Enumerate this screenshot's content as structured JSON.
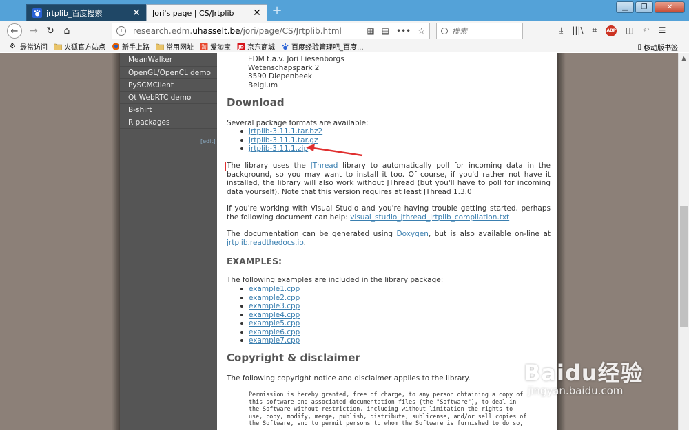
{
  "tabs": [
    {
      "label": "jrtplib_百度搜索",
      "active": false
    },
    {
      "label": "Jori's page | CS/Jrtplib",
      "active": true
    }
  ],
  "navbar": {
    "url_prefix": "research.edm.",
    "url_domain": "uhasselt.be",
    "url_path": "/jori/page/CS/Jrtplib.html",
    "search_placeholder": "搜索"
  },
  "bookmarks": [
    {
      "label": "最常访问",
      "icon": "gear-icon"
    },
    {
      "label": "火狐官方站点",
      "icon": "folder-icon"
    },
    {
      "label": "新手上路",
      "icon": "firefox-icon"
    },
    {
      "label": "常用网址",
      "icon": "folder-icon"
    },
    {
      "label": "爱淘宝",
      "icon": "taobao-icon"
    },
    {
      "label": "京东商城",
      "icon": "jd-icon"
    },
    {
      "label": "百度经验管理吧_百度...",
      "icon": "baidu-paw-icon"
    }
  ],
  "mobile_bookmarks": "移动版书签",
  "sidebar": {
    "items": [
      "MeanWalker",
      "OpenGL/OpenCL demo",
      "PySCMClient",
      "Qt WebRTC demo",
      "B-shirt",
      "R packages"
    ],
    "edit_label": "[edit]"
  },
  "content": {
    "address": [
      "EDM t.a.v. Jori Liesenborgs",
      "Wetenschapspark 2",
      "3590 Diepenbeek",
      "Belgium"
    ],
    "download_heading": "Download",
    "download_intro": "Several package formats are available:",
    "packages": [
      "jrtplib-3.11.1.tar.bz2",
      "jrtplib-3.11.1.tar.gz",
      "jrtplib-3.11.1.zip"
    ],
    "jthread_para": {
      "t1": "The library uses the ",
      "link": "JThread",
      "t2": " library to automatically poll for incoming data in the background, so you may want to install it too. Of course, if you'd rather not have it installed, the library will also work without JThread (but you'll have to poll for incoming data yourself). Note that this version requires at least JThread 1.3.0"
    },
    "vs_para": {
      "t1": "If you're working with Visual Studio and you're having trouble getting started, perhaps the following document can help: ",
      "link": "visual_studio_jthread_jrtplib_compilation.txt"
    },
    "doc_para": {
      "t1": "The documentation can be generated using ",
      "link1": "Doxygen",
      "t2": ", but is also available on-line at ",
      "link2": "jrtplib.readthedocs.io",
      "t3": "."
    },
    "examples_heading": "EXAMPLES:",
    "examples_intro": "The following examples are included in the library package:",
    "examples": [
      "example1.cpp",
      "example2.cpp",
      "example3.cpp",
      "example4.cpp",
      "example5.cpp",
      "example6.cpp",
      "example7.cpp"
    ],
    "copyright_heading": "Copyright & disclaimer",
    "copyright_intro": "The following copyright notice and disclaimer applies to the library.",
    "license_text": "Permission is hereby granted, free of charge, to any person obtaining a copy of\nthis software and associated documentation files (the \"Software\"), to deal in\nthe Software without restriction, including without limitation the rights to\nuse, copy, modify, merge, publish, distribute, sublicense, and/or sell copies of\nthe Software, and to permit persons to whom the Software is furnished to do so,"
  },
  "annotation": {
    "highlight_color": "#e03030",
    "arrow_target": "jrtplib-3.11.1.zip"
  },
  "watermark": {
    "text": "Baidu经验",
    "url": "jingyan.baidu.com"
  },
  "colors": {
    "titlebar": "#54a2d8",
    "sidebar": "#555555",
    "link": "#3a7fb0",
    "backdrop": "#8c8078"
  }
}
